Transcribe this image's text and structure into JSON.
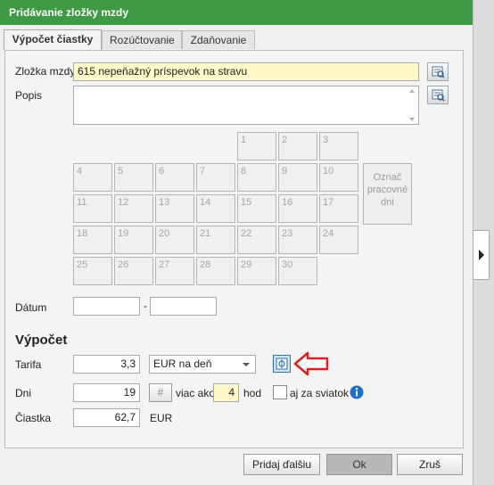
{
  "window": {
    "title": "Pridávanie zložky mzdy"
  },
  "tabs": [
    {
      "label": "Výpočet čiastky",
      "active": true
    },
    {
      "label": "Rozúčtovanie",
      "active": false
    },
    {
      "label": "Zdaňovanie",
      "active": false
    }
  ],
  "form": {
    "zlozka_label": "Zložka mzdy",
    "zlozka_value": "615  nepeňažný príspevok na stravu",
    "popis_label": "Popis",
    "popis_value": "",
    "datum_label": "Dátum",
    "datum_from": "",
    "datum_sep": "-",
    "datum_to": ""
  },
  "calendar": {
    "days": [
      "1",
      "2",
      "3",
      "4",
      "5",
      "6",
      "7",
      "8",
      "9",
      "10",
      "11",
      "12",
      "13",
      "14",
      "15",
      "16",
      "17",
      "18",
      "19",
      "20",
      "21",
      "22",
      "23",
      "24",
      "25",
      "26",
      "27",
      "28",
      "29",
      "30"
    ],
    "mark_button_label": "Označ pracovné dni"
  },
  "vypocet": {
    "heading": "Výpočet",
    "tarifa_label": "Tarifa",
    "tarifa_value": "3,3",
    "unit_select": "EUR na deň",
    "dni_label": "Dni",
    "dni_value": "19",
    "hash_label": "#",
    "viac_ako_label": "viac ako",
    "hod_value": "4",
    "hod_label": "hod",
    "sviatok_label": "aj za sviatok",
    "ciastka_label": "Čiastka",
    "ciastka_value": "62,7",
    "currency": "EUR"
  },
  "buttons": {
    "pridaj": "Pridaj ďalšiu",
    "ok": "Ok",
    "zrus": "Zruš"
  },
  "colors": {
    "titlebar": "#3e9a44",
    "required_field": "#fff8c8",
    "arrow": "#e02020",
    "info": "#1a6fd1"
  }
}
